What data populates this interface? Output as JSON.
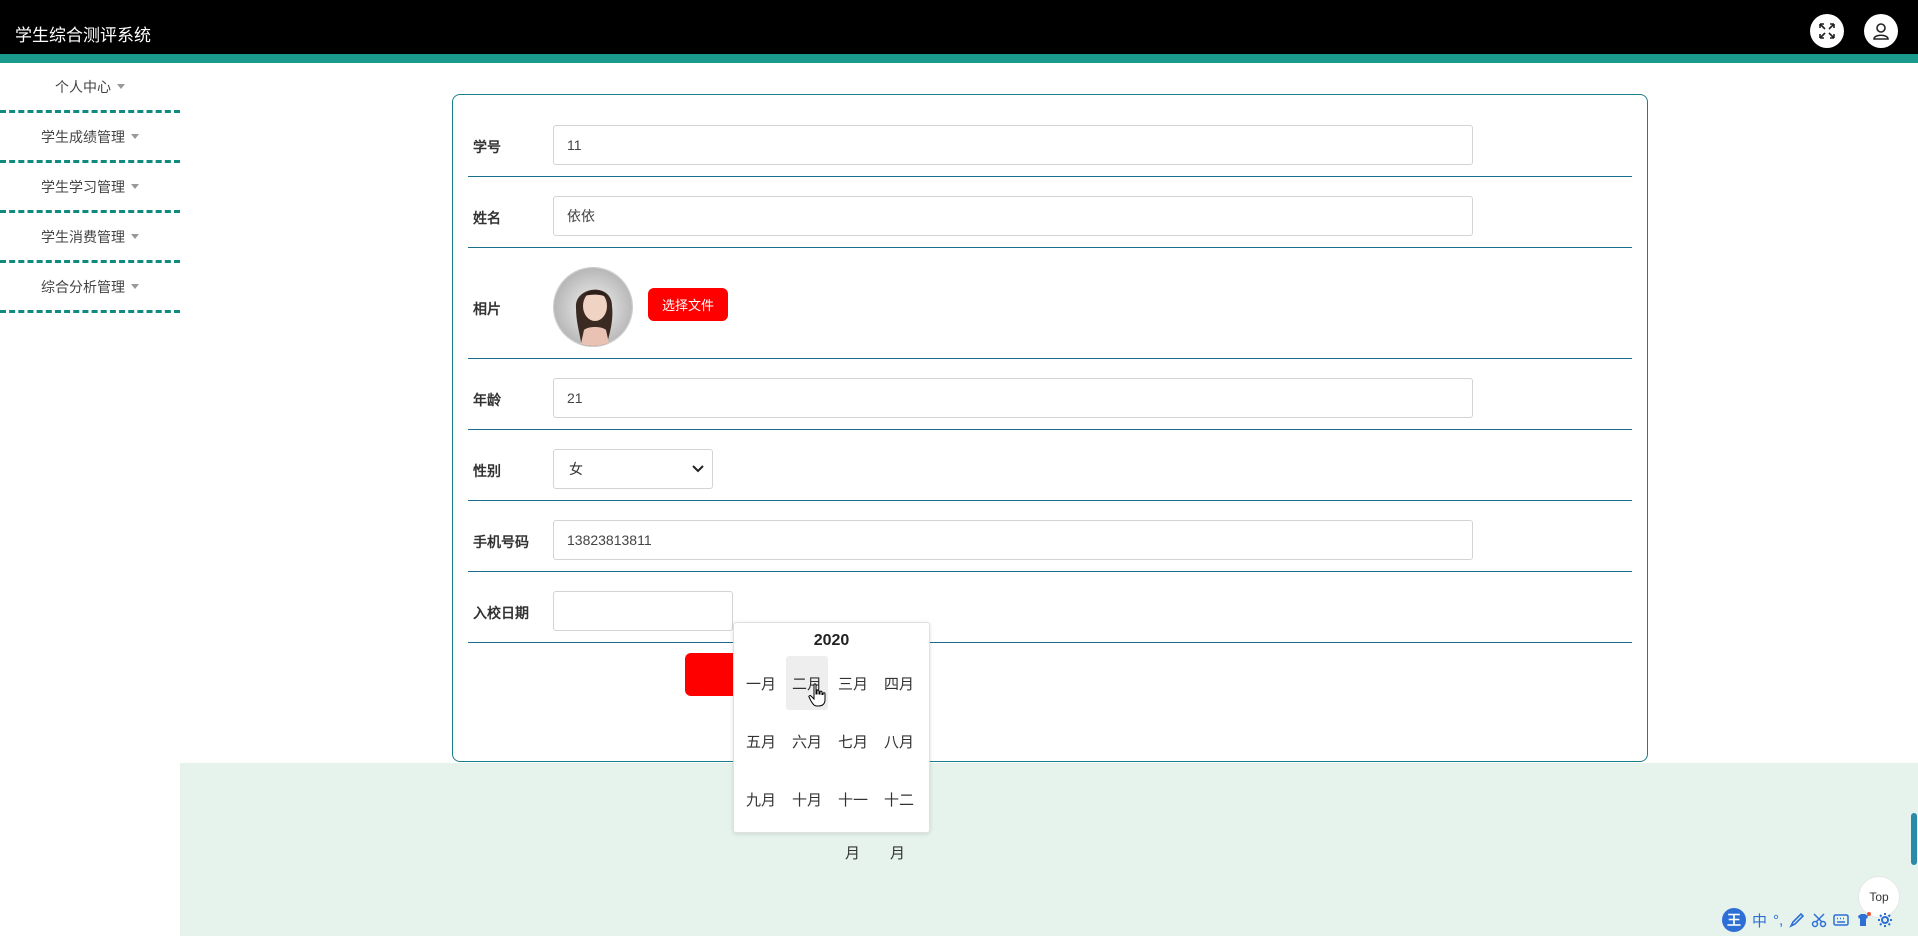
{
  "app": {
    "title": "学生综合测评系统"
  },
  "header": {
    "fullscreen_icon": "fullscreen-icon",
    "user_icon": "user-icon"
  },
  "sidebar": {
    "items": [
      {
        "label": "个人中心"
      },
      {
        "label": "学生成绩管理"
      },
      {
        "label": "学生学习管理"
      },
      {
        "label": "学生消费管理"
      },
      {
        "label": "综合分析管理"
      }
    ]
  },
  "form": {
    "student_id": {
      "label": "学号",
      "value": "11"
    },
    "name": {
      "label": "姓名",
      "value": "依依"
    },
    "photo": {
      "label": "相片",
      "button": "选择文件"
    },
    "age": {
      "label": "年龄",
      "value": "21"
    },
    "gender": {
      "label": "性别",
      "value": "女"
    },
    "phone": {
      "label": "手机号码",
      "value": "13823813811"
    },
    "enroll_date": {
      "label": "入校日期",
      "value": ""
    }
  },
  "month_picker": {
    "year": "2020",
    "months": [
      "一月",
      "二月",
      "三月",
      "四月",
      "五月",
      "六月",
      "七月",
      "八月",
      "九月",
      "十月",
      "十一",
      "十二"
    ],
    "overflow": [
      "月",
      "月"
    ],
    "hovered": "二月"
  },
  "top_button": {
    "label": "Top"
  },
  "ime_toolbar": {
    "logo": "王",
    "mode": "中"
  },
  "colors": {
    "accent": "#1a9a8c",
    "primary_button": "#ff0000",
    "header_bg": "#000000",
    "footer_bg": "#e6f3ec"
  }
}
